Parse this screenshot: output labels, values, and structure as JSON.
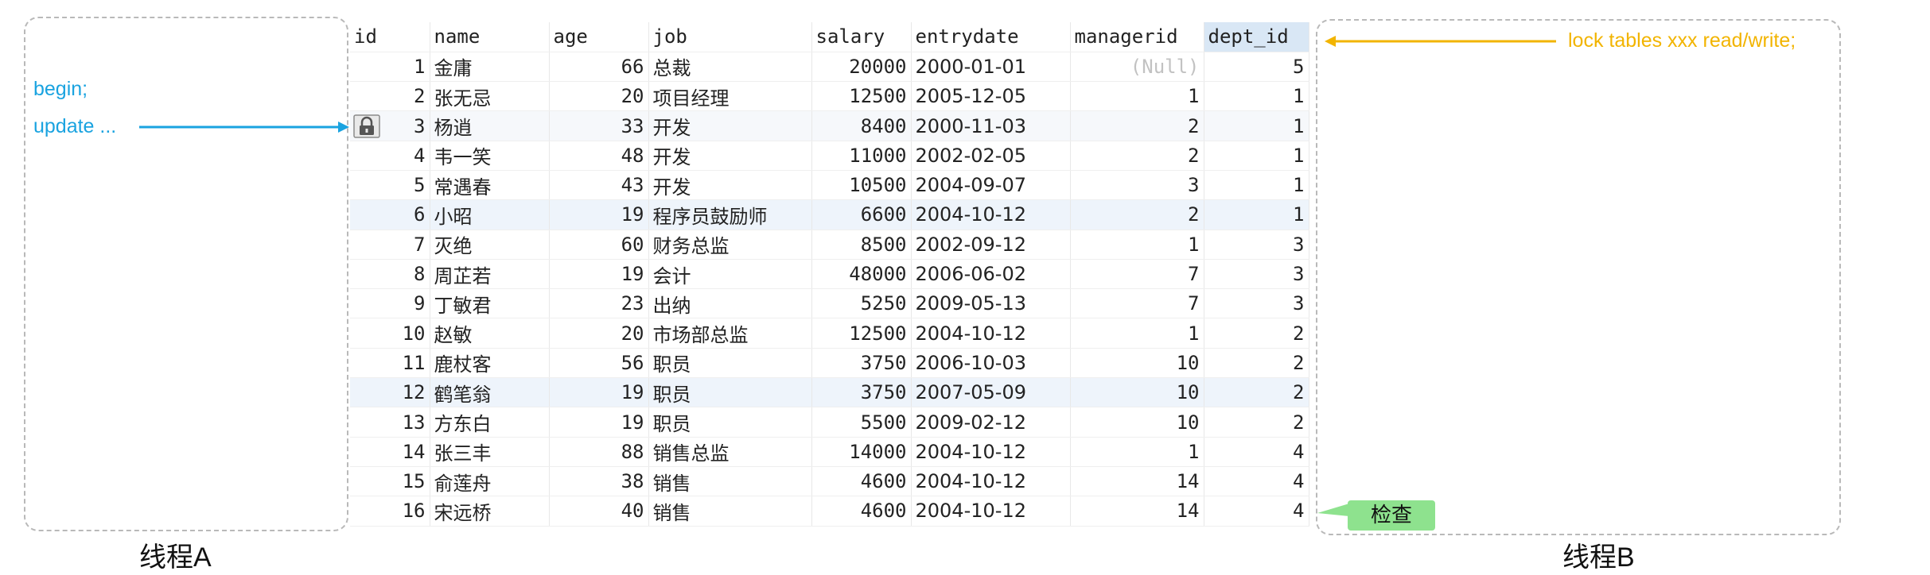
{
  "left_panel": {
    "title": "线程A",
    "lines": [
      "begin;",
      "update ..."
    ]
  },
  "right_panel": {
    "title": "线程B",
    "lock_text": "lock tables xxx read/write;",
    "check_label": "检查"
  },
  "colors": {
    "blue": "#1aa3e0",
    "gold": "#f2b400",
    "green": "#8ee28e"
  },
  "table": {
    "columns": [
      "id",
      "name",
      "age",
      "job",
      "salary",
      "entrydate",
      "managerid",
      "dept_id"
    ],
    "rows": [
      [
        "1",
        "金庸",
        "66",
        "总裁",
        "20000",
        "2000-01-01",
        "(Null)",
        "5"
      ],
      [
        "2",
        "张无忌",
        "20",
        "项目经理",
        "12500",
        "2005-12-05",
        "1",
        "1"
      ],
      [
        "3",
        "杨逍",
        "33",
        "开发",
        "8400",
        "2000-11-03",
        "2",
        "1"
      ],
      [
        "4",
        "韦一笑",
        "48",
        "开发",
        "11000",
        "2002-02-05",
        "2",
        "1"
      ],
      [
        "5",
        "常遇春",
        "43",
        "开发",
        "10500",
        "2004-09-07",
        "3",
        "1"
      ],
      [
        "6",
        "小昭",
        "19",
        "程序员鼓励师",
        "6600",
        "2004-10-12",
        "2",
        "1"
      ],
      [
        "7",
        "灭绝",
        "60",
        "财务总监",
        "8500",
        "2002-09-12",
        "1",
        "3"
      ],
      [
        "8",
        "周芷若",
        "19",
        "会计",
        "48000",
        "2006-06-02",
        "7",
        "3"
      ],
      [
        "9",
        "丁敏君",
        "23",
        "出纳",
        "5250",
        "2009-05-13",
        "7",
        "3"
      ],
      [
        "10",
        "赵敏",
        "20",
        "市场部总监",
        "12500",
        "2004-10-12",
        "1",
        "2"
      ],
      [
        "11",
        "鹿杖客",
        "56",
        "职员",
        "3750",
        "2006-10-03",
        "10",
        "2"
      ],
      [
        "12",
        "鹤笔翁",
        "19",
        "职员",
        "3750",
        "2007-05-09",
        "10",
        "2"
      ],
      [
        "13",
        "方东白",
        "19",
        "职员",
        "5500",
        "2009-02-12",
        "10",
        "2"
      ],
      [
        "14",
        "张三丰",
        "88",
        "销售总监",
        "14000",
        "2004-10-12",
        "1",
        "4"
      ],
      [
        "15",
        "俞莲舟",
        "38",
        "销售",
        "4600",
        "2004-10-12",
        "14",
        "4"
      ],
      [
        "16",
        "宋远桥",
        "40",
        "销售",
        "4600",
        "2004-10-12",
        "14",
        "4"
      ]
    ]
  }
}
